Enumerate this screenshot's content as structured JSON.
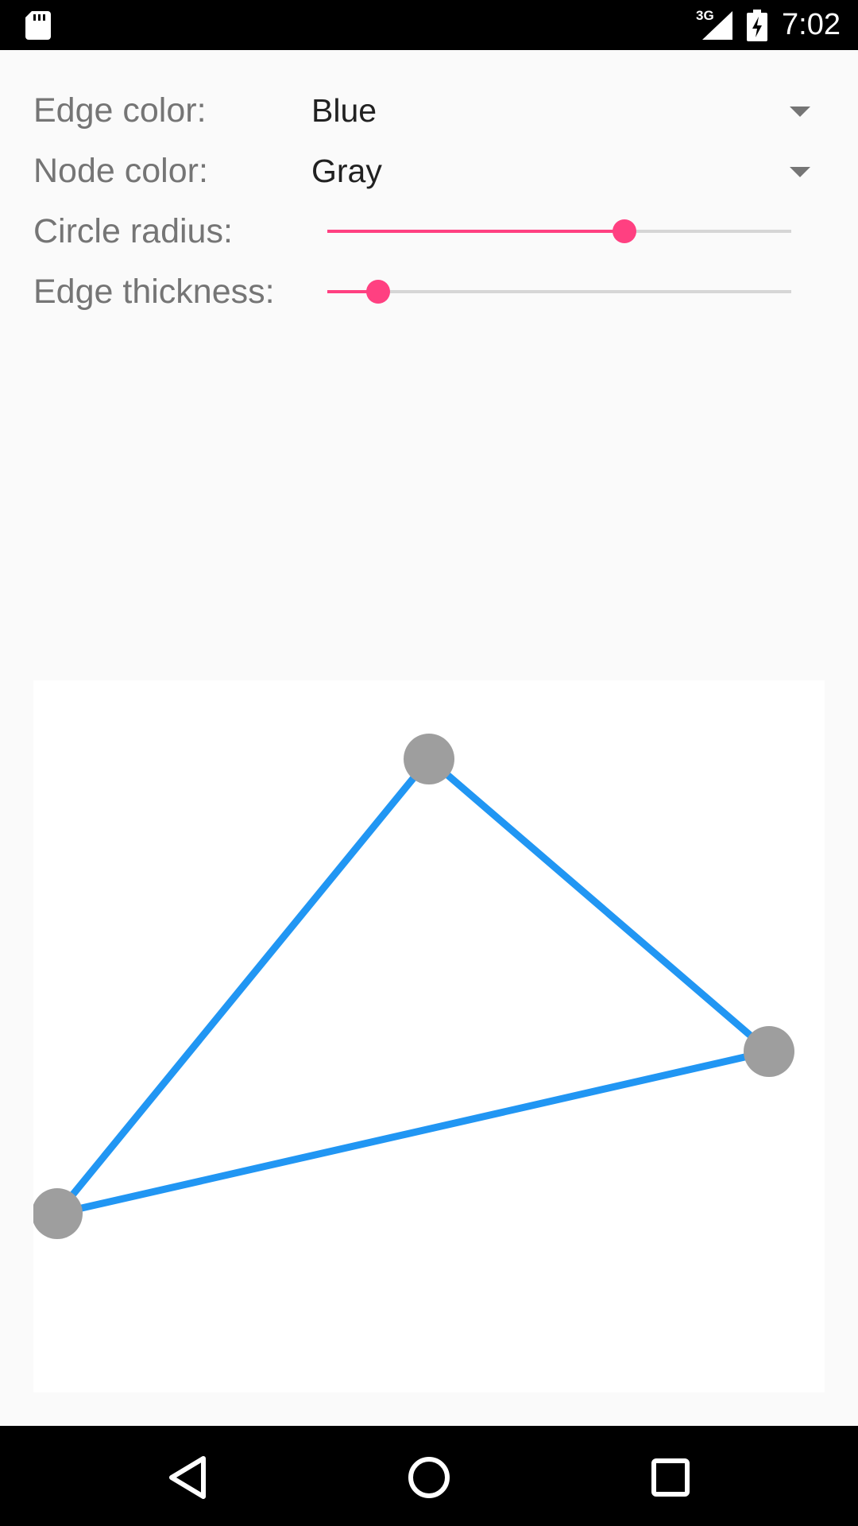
{
  "status_bar": {
    "network": "3G",
    "time": "7:02"
  },
  "controls": {
    "edge_color": {
      "label": "Edge color:",
      "value": "Blue"
    },
    "node_color": {
      "label": "Node color:",
      "value": "Gray"
    },
    "circle_radius": {
      "label": "Circle radius:",
      "level": 0.64
    },
    "edge_thickness": {
      "label": "Edge thickness:",
      "level": 0.11
    }
  },
  "colors": {
    "accent": "#ff4081",
    "edge": "#2196f3",
    "node": "#9e9e9e"
  },
  "icons": {
    "nav_back": "back-triangle-icon",
    "nav_home": "home-circle-icon",
    "nav_recents": "recents-square-icon"
  }
}
